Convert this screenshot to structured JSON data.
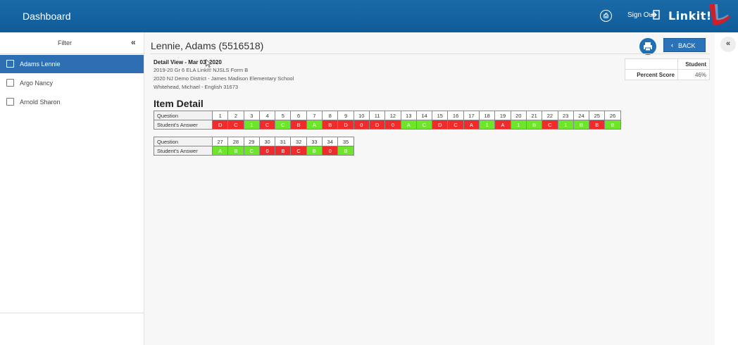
{
  "header": {
    "title": "Dashboard",
    "pdf_icon": "pdf-icon",
    "sign_out_label": "Sign Out",
    "logo_text": "Linkit!",
    "color": "#1366a6"
  },
  "sidebar": {
    "filter_title": "Filter",
    "collapse_label": "«",
    "items": [
      {
        "label": "Adams Lennie",
        "selected": true
      },
      {
        "label": "Argo Nancy",
        "selected": false
      },
      {
        "label": "Arnold Sharon",
        "selected": false
      }
    ]
  },
  "main": {
    "student_name": "Lennie, Adams (5516518)",
    "back_label": "BACK",
    "detail": {
      "heading": "Detail View - Mar 03, 2020",
      "line1": "2019-20 Gr 6 ELA LinkIt! NJSLS Form B",
      "line2": "2020 NJ Demo District - James Madison Elementary School",
      "line3": "Whitehead, Michael - English 31673"
    },
    "score": {
      "col_header": "Student",
      "row_label": "Percent Score",
      "value": "46%"
    },
    "item_detail_title": "Item Detail",
    "row_label_question": "Question",
    "row_label_answer": "Student's Answer",
    "rows1": {
      "questions": [
        "1",
        "2",
        "3",
        "4",
        "5",
        "6",
        "7",
        "8",
        "9",
        "10",
        "11",
        "12",
        "13",
        "14",
        "15",
        "16",
        "17",
        "18",
        "19",
        "20",
        "21",
        "22",
        "23",
        "24",
        "25",
        "26"
      ],
      "answers": [
        "D",
        "C",
        "1",
        "C",
        "C",
        "B",
        "A",
        "B",
        "D",
        "0",
        "D",
        "0",
        "A",
        "C",
        "D",
        "C",
        "A",
        "1",
        "A",
        "1",
        "B",
        "C",
        "1",
        "B",
        "B",
        "B"
      ],
      "status": [
        "r",
        "r",
        "g",
        "r",
        "g",
        "r",
        "g",
        "r",
        "r",
        "r",
        "r",
        "r",
        "g",
        "g",
        "r",
        "r",
        "r",
        "g",
        "r",
        "g",
        "g",
        "r",
        "g",
        "g",
        "r",
        "g"
      ]
    },
    "rows2": {
      "questions": [
        "27",
        "28",
        "29",
        "30",
        "31",
        "32",
        "33",
        "34",
        "35"
      ],
      "answers": [
        "A",
        "B",
        "C",
        "0",
        "B",
        "C",
        "B",
        "0",
        "B"
      ],
      "status": [
        "g",
        "g",
        "g",
        "r",
        "r",
        "r",
        "g",
        "r",
        "g"
      ]
    }
  },
  "right_panel": {
    "collapse_label": "«"
  },
  "colors": {
    "correct": "#6de52a",
    "incorrect": "#ef2b2b",
    "accent": "#2a73b8"
  }
}
